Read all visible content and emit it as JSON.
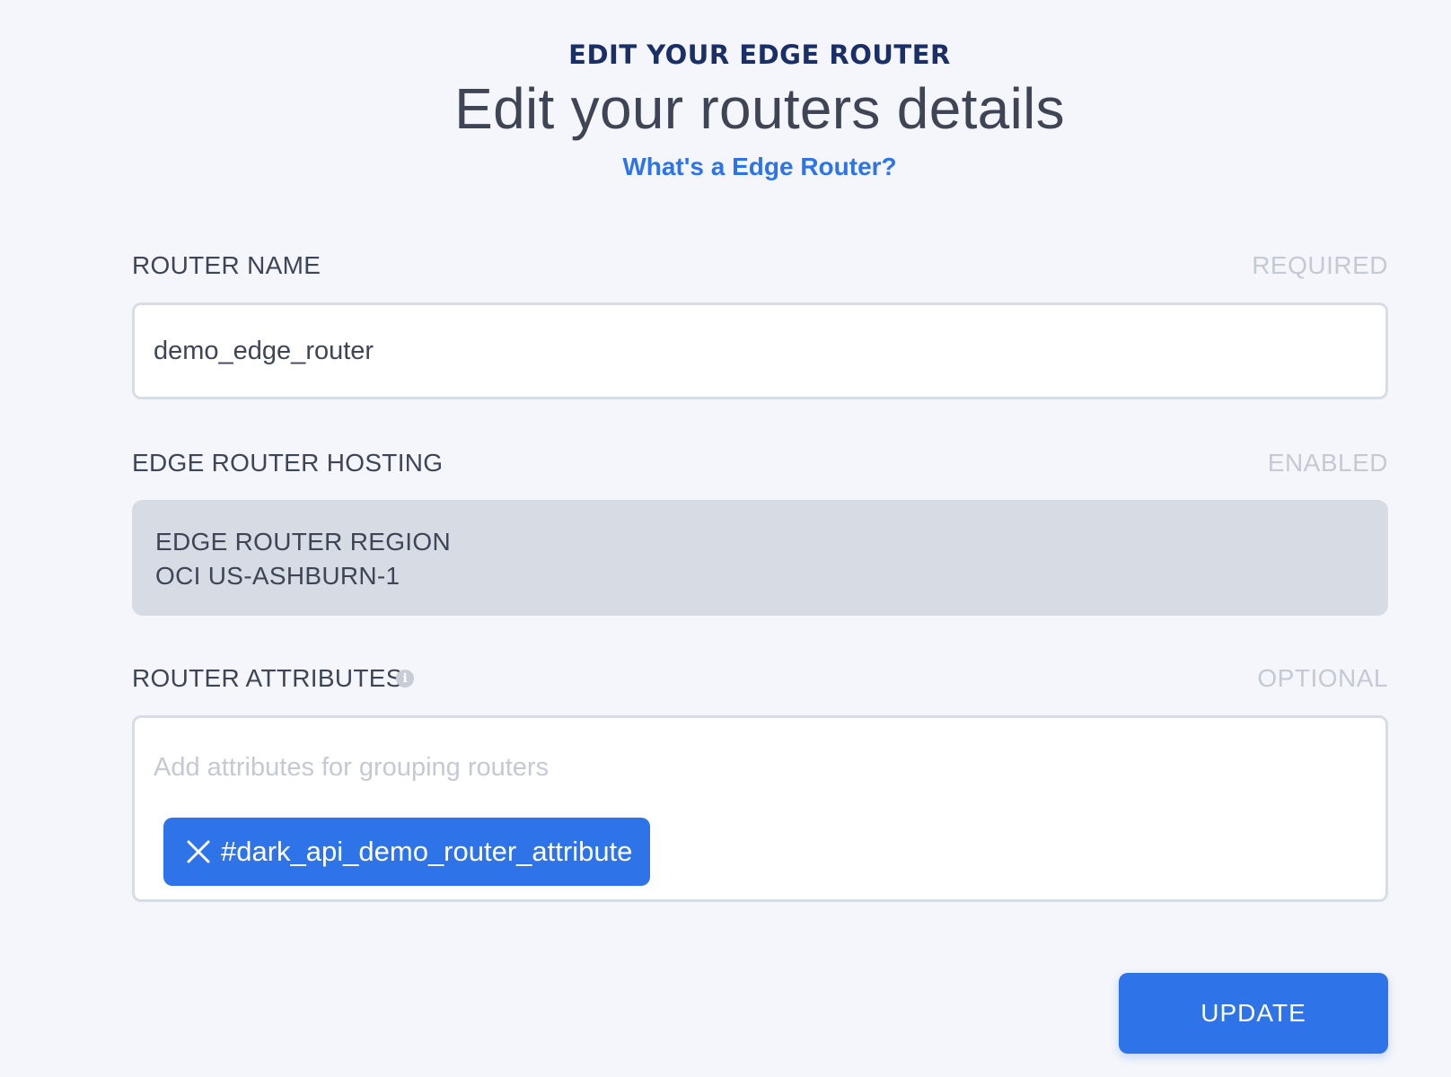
{
  "header": {
    "eyebrow": "EDIT YOUR EDGE ROUTER",
    "title": "Edit your routers details",
    "help_link": "What's a Edge Router?"
  },
  "router_name": {
    "label": "ROUTER NAME",
    "tag": "REQUIRED",
    "value": "demo_edge_router"
  },
  "hosting": {
    "label": "EDGE ROUTER HOSTING",
    "tag": "ENABLED",
    "region_label": "EDGE ROUTER REGION",
    "region_value": "OCI US-ASHBURN-1"
  },
  "attributes": {
    "label": "ROUTER ATTRIBUTES",
    "tag": "OPTIONAL",
    "placeholder": "Add attributes for grouping routers",
    "chips": [
      {
        "label": "#dark_api_demo_router_attribute"
      }
    ]
  },
  "actions": {
    "update_label": "UPDATE"
  },
  "colors": {
    "accent": "#2e74e8",
    "eyebrow": "#1a2f66",
    "background": "#f4f6fb",
    "muted": "#c4c9d4"
  },
  "icons": {
    "info": "info-icon",
    "remove_chip": "close-icon"
  }
}
